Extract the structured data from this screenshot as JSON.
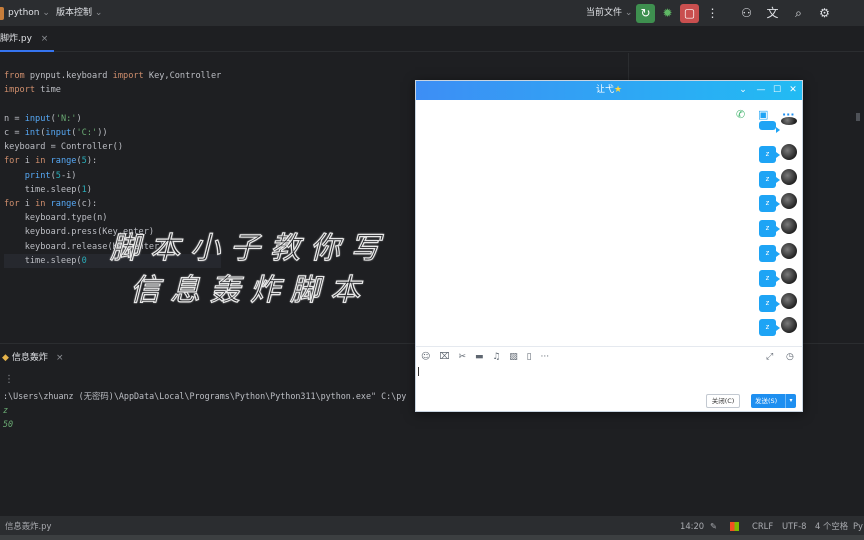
{
  "topbar": {
    "project": "python",
    "vcs": "版本控制",
    "run_config": "当前文件",
    "icons": [
      "run-icon",
      "debug-icon",
      "stop-icon",
      "more-icon",
      "add-user-icon",
      "translate-icon",
      "search-icon",
      "settings-icon"
    ]
  },
  "tab": {
    "filename": "脚炸.py",
    "close": "×"
  },
  "code_lines": [
    "from pynput.keyboard import Key,Controller",
    "import time",
    "",
    "n = input('N:')",
    "c = int(input('C:'))",
    "keyboard = Controller()",
    "for i in range(5):",
    "    print(5-i)",
    "    time.sleep(1)",
    "for i in range(c):",
    "    keyboard.type(n)",
    "    keyboard.press(Key.enter)",
    "    keyboard.release(Key.enter)",
    "    time.sleep(0"
  ],
  "overlay": {
    "line1": "脚本小子教你写",
    "line2": "信息轰炸脚本"
  },
  "run": {
    "tab_label": "信息轰炸",
    "close": "×",
    "more": "⋮",
    "command": ":\\Users\\zhuanz (无密码)\\AppData\\Local\\Programs\\Python\\Python311\\python.exe\" C:\\py",
    "input1": "z",
    "input2": "50"
  },
  "chat": {
    "title": "让弋",
    "star": "★",
    "controls": [
      "⌄",
      "—",
      "☐",
      "✕"
    ],
    "top_icons": {
      "phone": "✆",
      "video": "▣",
      "more": "···"
    },
    "message_text": "z",
    "message_count": 9,
    "tools": [
      "☺",
      "⌧",
      "✂",
      "▬",
      "♫",
      "▨",
      "▯",
      "···"
    ],
    "tool_right": [
      "⤢",
      "◷"
    ],
    "close_label": "关闭(C)",
    "send_label": "发送(S)",
    "send_arrow": "▾"
  },
  "status": {
    "file": "信息轰炸.py",
    "position": "14:20",
    "line_sep": "CRLF",
    "encoding": "UTF-8",
    "indent": "4 个空格",
    "interpreter": "Py"
  }
}
